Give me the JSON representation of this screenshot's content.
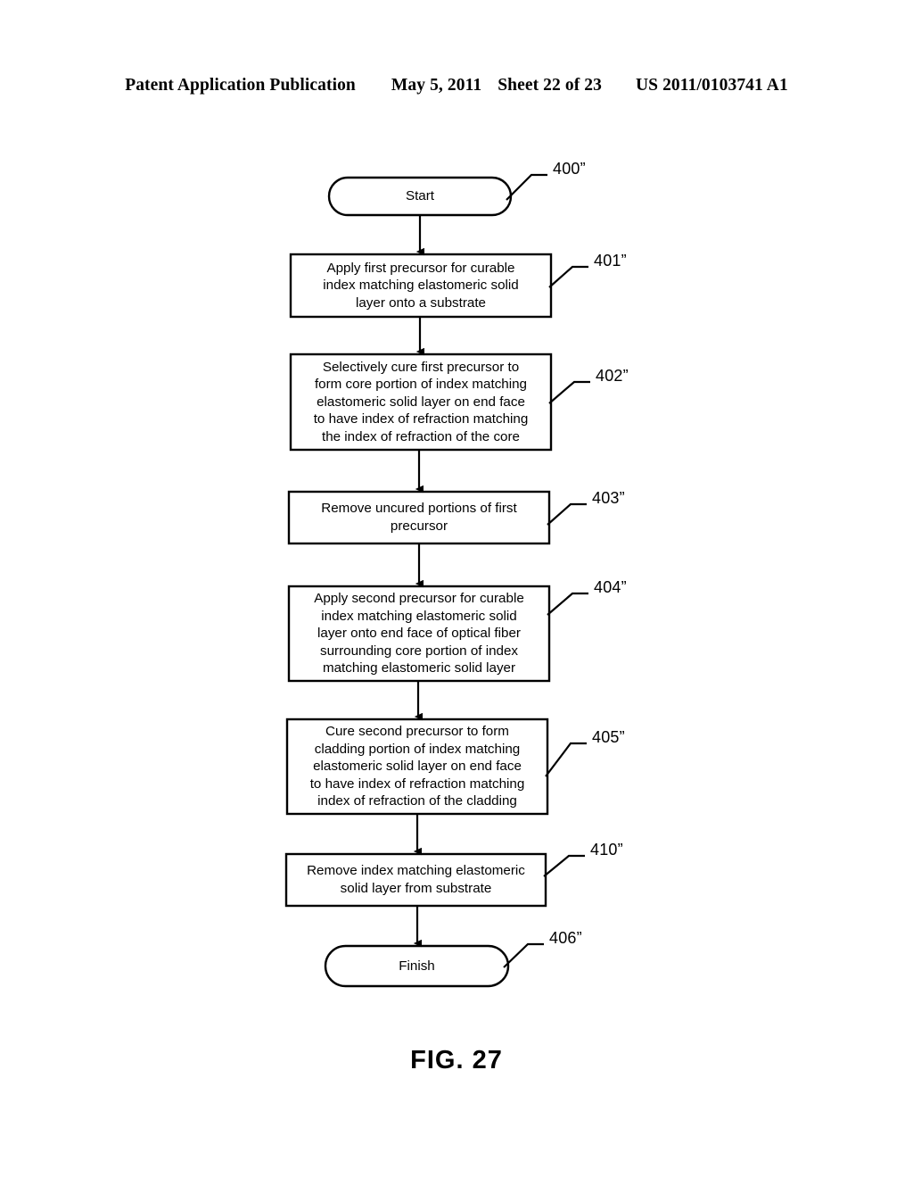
{
  "header": {
    "publication_type": "Patent Application Publication",
    "date": "May 5, 2011",
    "sheet": "Sheet 22 of 23",
    "publication_number": "US 2011/0103741 A1"
  },
  "figure": {
    "caption": "FIG. 27",
    "type": "flowchart",
    "stroke_color": "#000000",
    "fill_color": "#ffffff"
  },
  "flowchart": {
    "nodes": [
      {
        "id": "start",
        "shape": "stadium",
        "text": "Start",
        "ref": "400”"
      },
      {
        "id": "step401",
        "shape": "rectangle",
        "text": "Apply first precursor for curable\nindex matching elastomeric solid\nlayer onto a substrate",
        "ref": "401”"
      },
      {
        "id": "step402",
        "shape": "rectangle",
        "text": "Selectively cure first precursor to\nform core portion of index matching\nelastomeric solid layer on end face\nto have index of refraction matching\nthe index of refraction of the core",
        "ref": "402”"
      },
      {
        "id": "step403",
        "shape": "rectangle",
        "text": "Remove uncured portions of first\nprecursor",
        "ref": "403”"
      },
      {
        "id": "step404",
        "shape": "rectangle",
        "text": "Apply second precursor for curable\nindex matching elastomeric solid\nlayer onto end face of optical fiber\nsurrounding core portion of index\nmatching elastomeric solid layer",
        "ref": "404”"
      },
      {
        "id": "step405",
        "shape": "rectangle",
        "text": "Cure second precursor to form\ncladding portion of index matching\nelastomeric solid layer on end face\nto have index of refraction matching\nindex of refraction of the cladding",
        "ref": "405”"
      },
      {
        "id": "step410",
        "shape": "rectangle",
        "text": "Remove index matching elastomeric\nsolid layer from substrate",
        "ref": "410”"
      },
      {
        "id": "finish",
        "shape": "stadium",
        "text": "Finish",
        "ref": "406”"
      }
    ]
  }
}
